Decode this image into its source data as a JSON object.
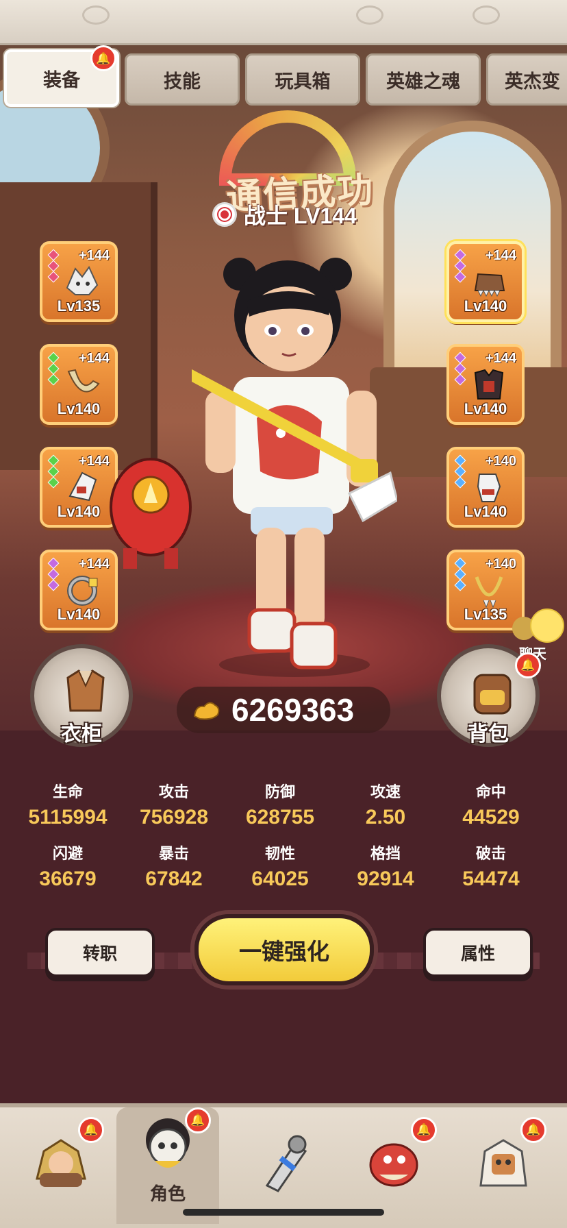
{
  "tabs": [
    {
      "label": "装备",
      "active": true,
      "badge": true
    },
    {
      "label": "技能",
      "active": false
    },
    {
      "label": "玩具箱",
      "active": false
    },
    {
      "label": "英雄之魂",
      "active": false
    },
    {
      "label": "英杰变",
      "active": false
    }
  ],
  "header": {
    "status_text": "通信成功",
    "class_name": "战士 LV144"
  },
  "equipment": {
    "left": [
      {
        "plus": "+144",
        "level": "Lv135",
        "gem_color": "#e8537a",
        "item_icon": "beast-helmet-icon"
      },
      {
        "plus": "+144",
        "level": "Lv140",
        "gem_color": "#5ad24a",
        "item_icon": "boomerang-icon"
      },
      {
        "plus": "+144",
        "level": "Lv140",
        "gem_color": "#5ad24a",
        "item_icon": "gauntlet-icon"
      },
      {
        "plus": "+144",
        "level": "Lv140",
        "gem_color": "#c46ae0",
        "item_icon": "ring-icon"
      }
    ],
    "right": [
      {
        "plus": "+144",
        "level": "Lv140",
        "gem_color": "#c46ae0",
        "item_icon": "spiked-shoe-icon"
      },
      {
        "plus": "+144",
        "level": "Lv140",
        "gem_color": "#c46ae0",
        "item_icon": "armor-icon"
      },
      {
        "plus": "+140",
        "level": "Lv140",
        "gem_color": "#5ab0ff",
        "item_icon": "glove-icon"
      },
      {
        "plus": "+140",
        "level": "Lv135",
        "gem_color": "#5ab0ff",
        "item_icon": "necklace-icon"
      }
    ]
  },
  "chat": {
    "label": "聊天"
  },
  "wardrobe": {
    "label": "衣柜"
  },
  "backpack": {
    "label": "背包"
  },
  "power": {
    "value": "6269363"
  },
  "stats": [
    {
      "label": "生命",
      "value": "5115994"
    },
    {
      "label": "攻击",
      "value": "756928"
    },
    {
      "label": "防御",
      "value": "628755"
    },
    {
      "label": "攻速",
      "value": "2.50"
    },
    {
      "label": "命中",
      "value": "44529"
    },
    {
      "label": "闪避",
      "value": "36679"
    },
    {
      "label": "暴击",
      "value": "67842"
    },
    {
      "label": "韧性",
      "value": "64025"
    },
    {
      "label": "格挡",
      "value": "92914"
    },
    {
      "label": "破击",
      "value": "54474"
    }
  ],
  "actions": {
    "job_change": "转职",
    "one_click_enhance": "一键强化",
    "attributes": "属性"
  },
  "nav": [
    {
      "label": "",
      "icon": "caveman-icon",
      "badge": true
    },
    {
      "label": "角色",
      "icon": "character-icon",
      "badge": true,
      "active": true
    },
    {
      "label": "",
      "icon": "weapon-icon",
      "badge": false
    },
    {
      "label": "",
      "icon": "pet-dino-icon",
      "badge": true
    },
    {
      "label": "",
      "icon": "totem-icon",
      "badge": true
    }
  ],
  "colors": {
    "accent_gold": "#f8c95a",
    "badge_red": "#e53b2e",
    "slot_orange": "#e98a36"
  }
}
